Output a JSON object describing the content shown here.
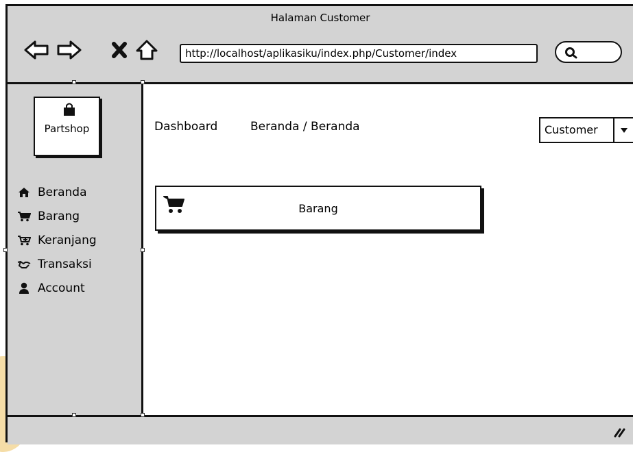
{
  "window": {
    "title": "Halaman Customer",
    "url": "http://localhost/aplikasiku/index.php/Customer/index"
  },
  "nav_icons": [
    "back-arrow-icon",
    "forward-arrow-icon",
    "close-icon",
    "home-icon"
  ],
  "search": {
    "icon": "search-icon"
  },
  "sidebar": {
    "logo_label": "Partshop",
    "logo_icon": "shopping-bag-icon",
    "items": [
      {
        "label": "Beranda",
        "icon": "home-icon"
      },
      {
        "label": "Barang",
        "icon": "cart-icon"
      },
      {
        "label": "Keranjang",
        "icon": "cart-plus-icon"
      },
      {
        "label": "Transaksi",
        "icon": "handshake-icon"
      },
      {
        "label": "Account",
        "icon": "user-icon"
      }
    ]
  },
  "main": {
    "dashboard_label": "Dashboard",
    "breadcrumb": "Beranda / Beranda",
    "user_select": "Customer",
    "card": {
      "label": "Barang",
      "icon": "cart-icon"
    }
  },
  "colors": {
    "chrome_gray": "#d3d3d3",
    "border": "#111111",
    "watermark": "#f2d28a"
  }
}
